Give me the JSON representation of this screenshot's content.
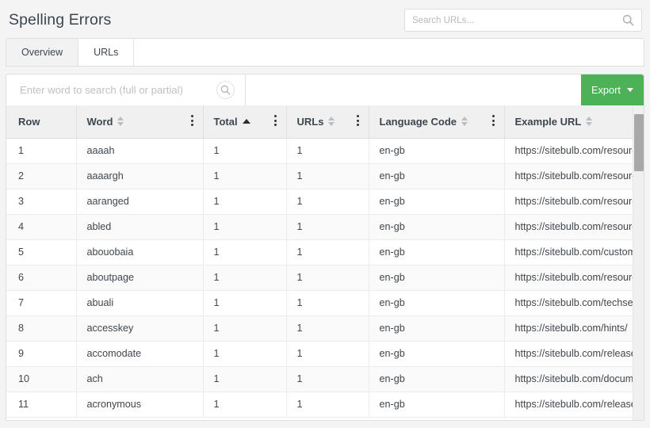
{
  "header": {
    "title": "Spelling Errors",
    "url_search": {
      "placeholder": "Search URLs...",
      "value": ""
    }
  },
  "tabs": [
    {
      "label": "Overview",
      "active": false
    },
    {
      "label": "URLs",
      "active": true
    }
  ],
  "toolbar": {
    "word_search": {
      "placeholder": "Enter word to search (full or partial)",
      "value": ""
    },
    "export_label": "Export"
  },
  "table": {
    "columns": [
      {
        "label": "Row",
        "sort": "none",
        "kebab": false
      },
      {
        "label": "Word",
        "sort": "both",
        "kebab": true
      },
      {
        "label": "Total",
        "sort": "asc",
        "kebab": true
      },
      {
        "label": "URLs",
        "sort": "both",
        "kebab": true
      },
      {
        "label": "Language Code",
        "sort": "both",
        "kebab": true
      },
      {
        "label": "Example URL",
        "sort": "both",
        "kebab": false
      }
    ],
    "rows": [
      {
        "row": "1",
        "word": "aaaah",
        "total": "1",
        "urls": "1",
        "language_code": "en-gb",
        "example_url": "https://sitebulb.com/resources/"
      },
      {
        "row": "2",
        "word": "aaaargh",
        "total": "1",
        "urls": "1",
        "language_code": "en-gb",
        "example_url": "https://sitebulb.com/resources/"
      },
      {
        "row": "3",
        "word": "aaranged",
        "total": "1",
        "urls": "1",
        "language_code": "en-gb",
        "example_url": "https://sitebulb.com/resources/"
      },
      {
        "row": "4",
        "word": "abled",
        "total": "1",
        "urls": "1",
        "language_code": "en-gb",
        "example_url": "https://sitebulb.com/resources/"
      },
      {
        "row": "5",
        "word": "abouobaia",
        "total": "1",
        "urls": "1",
        "language_code": "en-gb",
        "example_url": "https://sitebulb.com/customers/"
      },
      {
        "row": "6",
        "word": "aboutpage",
        "total": "1",
        "urls": "1",
        "language_code": "en-gb",
        "example_url": "https://sitebulb.com/resources/"
      },
      {
        "row": "7",
        "word": "abuali",
        "total": "1",
        "urls": "1",
        "language_code": "en-gb",
        "example_url": "https://sitebulb.com/techseo/"
      },
      {
        "row": "8",
        "word": "accesskey",
        "total": "1",
        "urls": "1",
        "language_code": "en-gb",
        "example_url": "https://sitebulb.com/hints/"
      },
      {
        "row": "9",
        "word": "accomodate",
        "total": "1",
        "urls": "1",
        "language_code": "en-gb",
        "example_url": "https://sitebulb.com/releases/"
      },
      {
        "row": "10",
        "word": "ach",
        "total": "1",
        "urls": "1",
        "language_code": "en-gb",
        "example_url": "https://sitebulb.com/documentation/"
      },
      {
        "row": "11",
        "word": "acronymous",
        "total": "1",
        "urls": "1",
        "language_code": "en-gb",
        "example_url": "https://sitebulb.com/releases/"
      }
    ]
  },
  "colors": {
    "export_green": "#4cb157",
    "page_background": "#f4f4f4",
    "header_row": "#f0f0f0"
  },
  "icons": {
    "search": "search-icon",
    "kebab": "kebab-menu-icon",
    "caret_down": "chevron-down-icon"
  }
}
